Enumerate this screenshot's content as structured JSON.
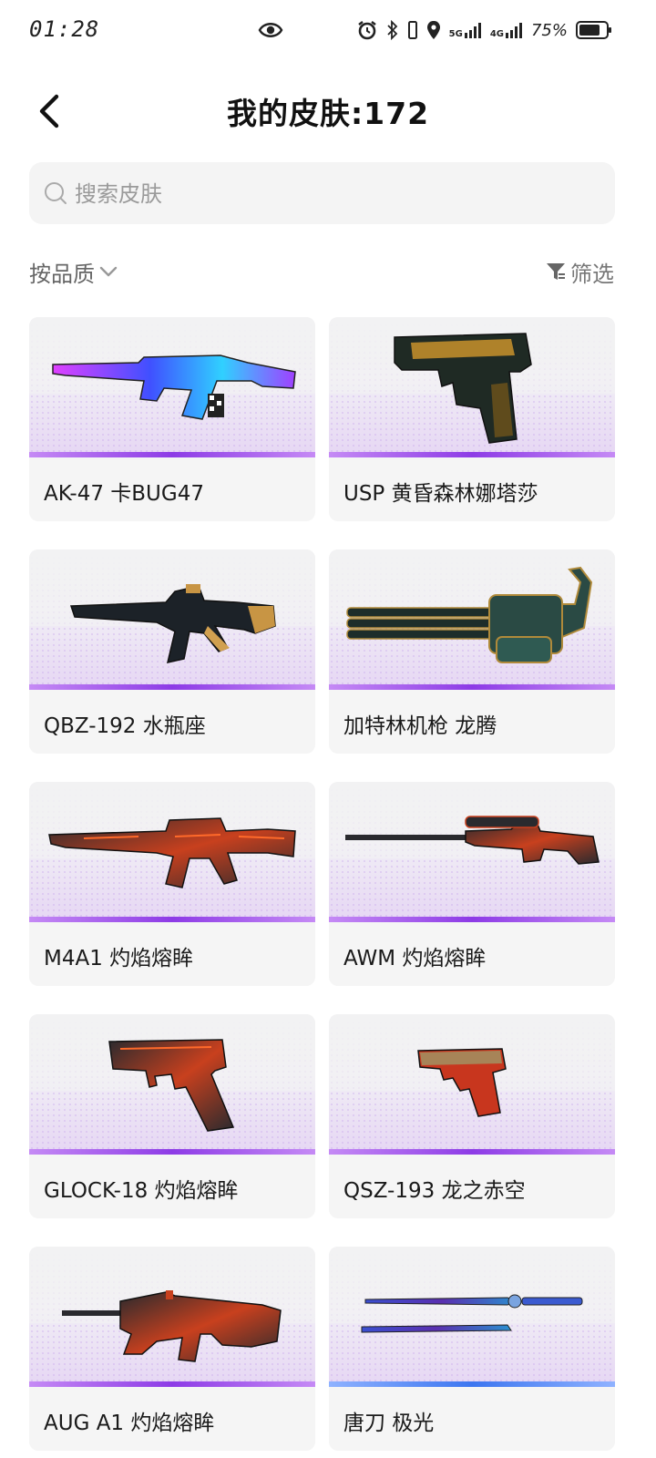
{
  "status_bar": {
    "time": "01:28",
    "signal_1": "5G",
    "signal_2": "4G",
    "battery": "75%"
  },
  "header": {
    "title": "我的皮肤:172"
  },
  "search": {
    "placeholder": "搜索皮肤"
  },
  "toolbar": {
    "sort_label": "按品质",
    "filter_label": "筛选"
  },
  "skins": [
    {
      "name": "AK-47 卡BUG47",
      "weapon_icon": "rifle-icon",
      "rarity_color": "#8d3be6"
    },
    {
      "name": "USP 黄昏森林娜塔莎",
      "weapon_icon": "pistol-icon",
      "rarity_color": "#8d3be6"
    },
    {
      "name": "QBZ-192 水瓶座",
      "weapon_icon": "rifle-icon",
      "rarity_color": "#8d3be6"
    },
    {
      "name": "加特林机枪 龙腾",
      "weapon_icon": "minigun-icon",
      "rarity_color": "#8d3be6"
    },
    {
      "name": "M4A1 灼焰熔眸",
      "weapon_icon": "rifle-icon",
      "rarity_color": "#8d3be6"
    },
    {
      "name": "AWM 灼焰熔眸",
      "weapon_icon": "sniper-icon",
      "rarity_color": "#8d3be6"
    },
    {
      "name": "GLOCK-18 灼焰熔眸",
      "weapon_icon": "pistol-icon",
      "rarity_color": "#8d3be6"
    },
    {
      "name": "QSZ-193 龙之赤空",
      "weapon_icon": "pistol-icon",
      "rarity_color": "#8d3be6"
    },
    {
      "name": "AUG A1 灼焰熔眸",
      "weapon_icon": "bullpup-icon",
      "rarity_color": "#8d3be6"
    },
    {
      "name": "唐刀 极光",
      "weapon_icon": "sword-icon",
      "rarity_color": "#3d76f0"
    }
  ]
}
